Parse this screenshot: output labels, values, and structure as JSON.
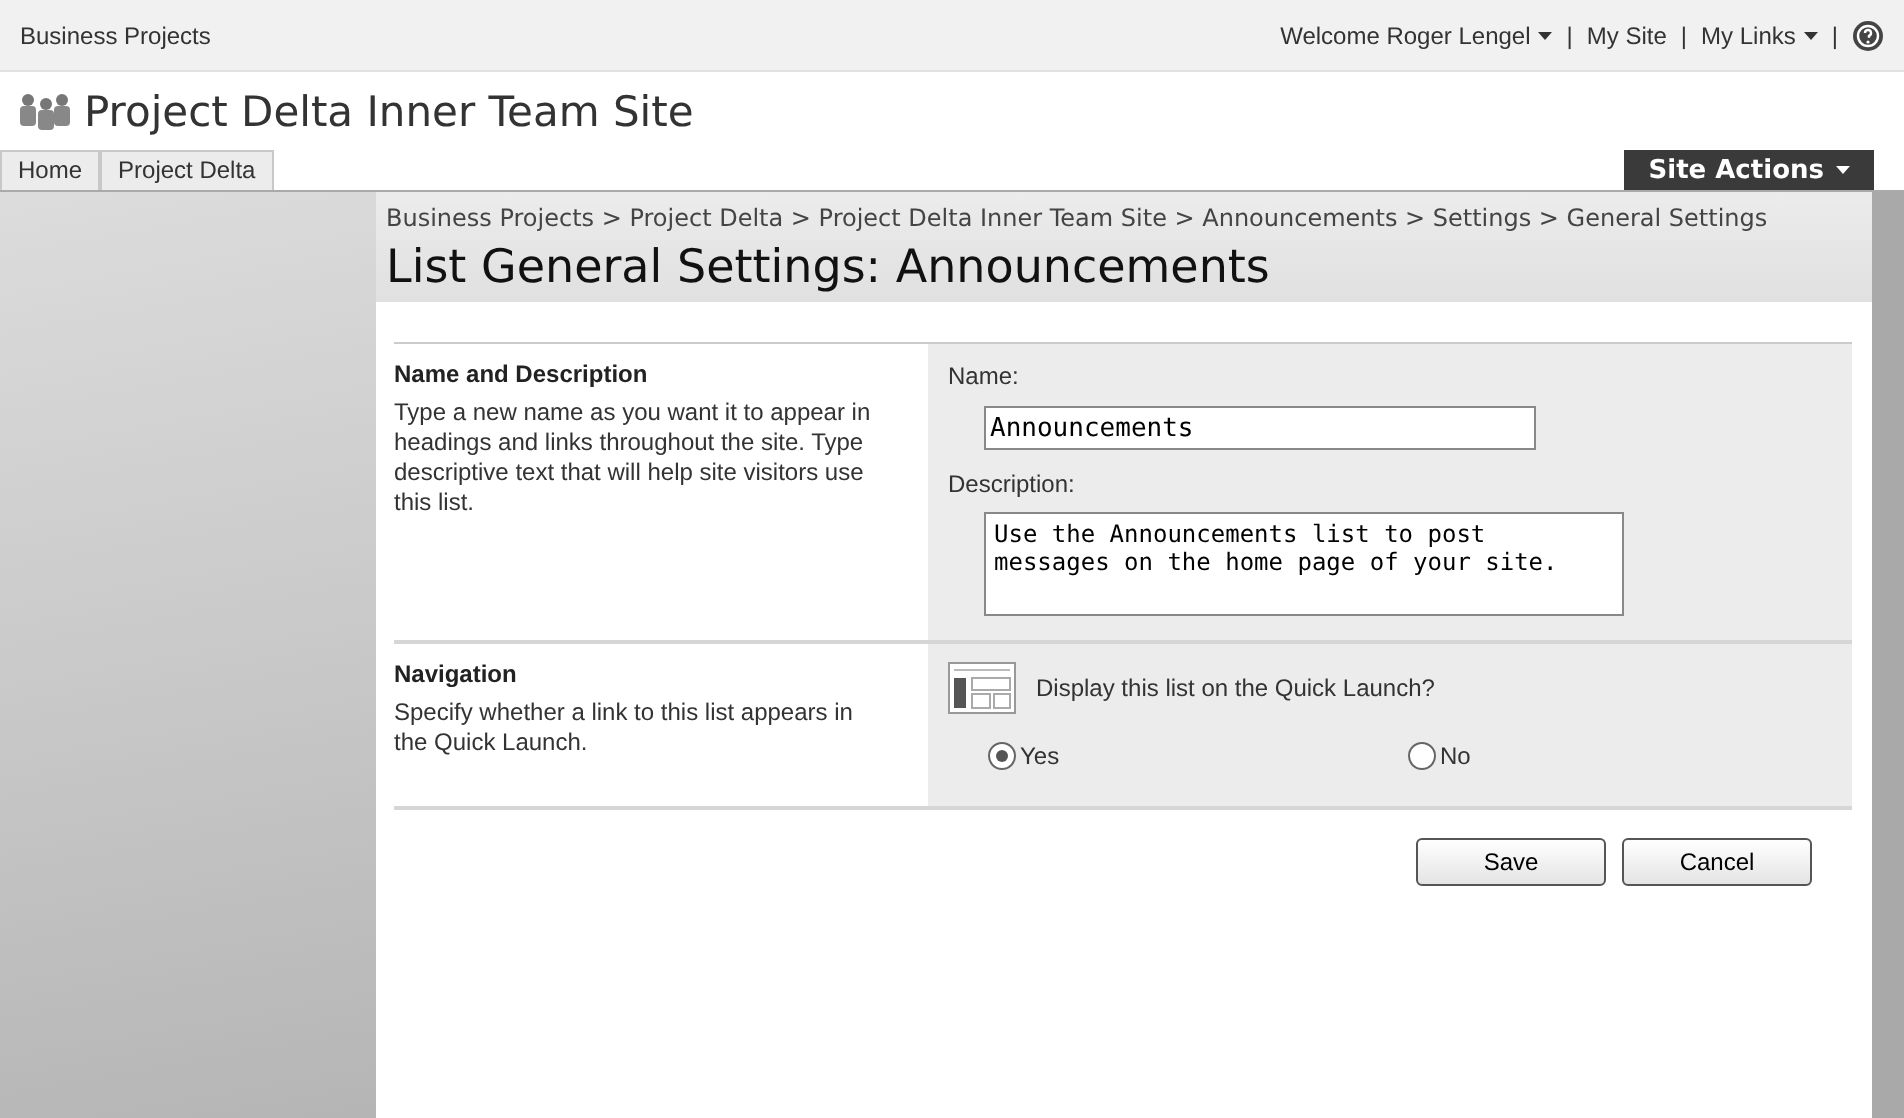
{
  "top_bar": {
    "site": "Business Projects",
    "welcome": "Welcome Roger Lengel",
    "my_site": "My Site",
    "my_links": "My Links",
    "separator": "|"
  },
  "site_title": "Project Delta Inner Team Site",
  "nav_tabs": [
    {
      "label": "Home",
      "selected": false
    },
    {
      "label": "Project Delta",
      "selected": false
    }
  ],
  "site_actions": "Site Actions",
  "breadcrumb": "Business Projects > Project Delta > Project Delta Inner Team Site > Announcements > Settings > General Settings",
  "page_title": "List General Settings: Announcements",
  "sections": [
    {
      "kind": "name",
      "heading": "Name and Description",
      "description": "Type a new name as you want it to appear in headings and links throughout the site. Type descriptive text that will help site visitors use this list.",
      "name_label": "Name:",
      "name_value": "Announcements",
      "description_label": "Description:",
      "description_value": "Use the Announcements list to post messages on the home page of your site."
    },
    {
      "kind": "navigation",
      "heading": "Navigation",
      "description": "Specify whether a link to this list appears in the Quick Launch.",
      "question": "Display this list on the Quick Launch?",
      "options": [
        {
          "label": "Yes",
          "selected": true
        },
        {
          "label": "No",
          "selected": false
        }
      ]
    }
  ],
  "buttons": [
    "Save",
    "Cancel"
  ]
}
